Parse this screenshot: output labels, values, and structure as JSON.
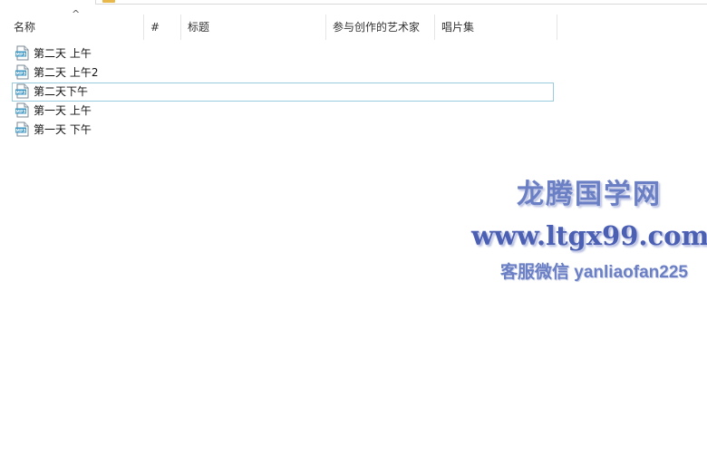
{
  "columns": {
    "name": "名称",
    "number": "#",
    "title": "标题",
    "artists": "参与创作的艺术家",
    "album": "唱片集"
  },
  "sort_indicator": "^",
  "files": [
    {
      "name": "第二天 上午",
      "icon": "mp3-file-icon"
    },
    {
      "name": "第二天 上午2",
      "icon": "mp3-file-icon"
    },
    {
      "name": "第二天下午",
      "icon": "mp3-file-icon",
      "focused": true
    },
    {
      "name": "第一天 上午",
      "icon": "mp3-file-icon"
    },
    {
      "name": "第一天 下午",
      "icon": "mp3-file-icon"
    }
  ],
  "watermark": {
    "title": "龙腾国学网",
    "url": "www.ltgx99.com",
    "contact": "客服微信 yanliaofan225"
  },
  "colors": {
    "focus_border": "#99cbe0",
    "watermark": "#5a6fb8",
    "folder_accent": "#e8b84a"
  }
}
